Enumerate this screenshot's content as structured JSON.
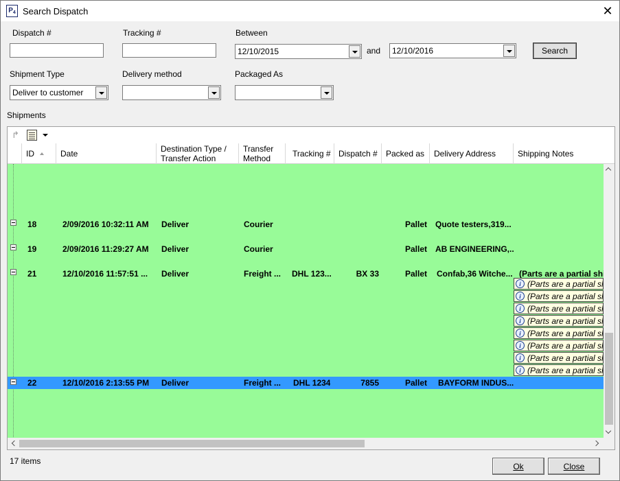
{
  "window": {
    "title": "Search Dispatch",
    "icon_text": "P",
    "icon_sub": "4"
  },
  "filters": {
    "dispatch_label": "Dispatch #",
    "dispatch_value": "",
    "tracking_label": "Tracking #",
    "tracking_value": "",
    "between_label": "Between",
    "from_date": "12/10/2015",
    "and_label": "and",
    "to_date": "12/10/2016",
    "search_label": "Search",
    "shipment_type_label": "Shipment Type",
    "shipment_type_value": "Deliver to customer",
    "delivery_method_label": "Delivery method",
    "delivery_method_value": "",
    "packaged_as_label": "Packaged As",
    "packaged_as_value": ""
  },
  "shipments": {
    "section_label": "Shipments",
    "columns": [
      "ID",
      "Date",
      "Destination Type /\nTransfer Action",
      "Transfer\nMethod",
      "Tracking #",
      "Dispatch #",
      "Packed as",
      "Delivery Address",
      "Shipping Notes"
    ],
    "rows": [
      {
        "id": "18",
        "date": "2/09/2016 10:32:11 AM",
        "dest": "Deliver",
        "method": "Courier",
        "tracking": "",
        "dispatch": "",
        "packed": "Pallet",
        "address": "Quote testers,319...",
        "notes": ""
      },
      {
        "id": "19",
        "date": "2/09/2016 11:29:27 AM",
        "dest": "Deliver",
        "method": "Courier",
        "tracking": "",
        "dispatch": "",
        "packed": "Pallet",
        "address": "AB ENGINEERING,...",
        "notes": ""
      },
      {
        "id": "21",
        "date": "12/10/2016 11:57:51 ...",
        "dest": "Deliver",
        "method": "Freight ...",
        "tracking": "DHL 123...",
        "dispatch": "BX 33",
        "packed": "Pallet",
        "address": "Confab,36 Witche...",
        "notes": "(Parts are a partial ship"
      },
      {
        "id": "22",
        "date": "12/10/2016 2:13:55 PM",
        "dest": "Deliver",
        "method": "Freight ...",
        "tracking": "DHL 1234",
        "dispatch": "7855",
        "packed": "Pallet",
        "address": "BAYFORM INDUS...",
        "notes": ""
      }
    ],
    "note_items": [
      "(Parts are a partial sh",
      "(Parts are a partial sh",
      "(Parts are a partial sh",
      "(Parts are a partial sh",
      "(Parts are a partial sh",
      "(Parts are a partial sh",
      "(Parts are a partial sh",
      "(Parts are a partial sh"
    ],
    "row_color": "#98fb98",
    "selected_color": "#3399ff"
  },
  "footer": {
    "count_text": "17 items",
    "ok_label": "Ok",
    "close_label": "Close"
  }
}
